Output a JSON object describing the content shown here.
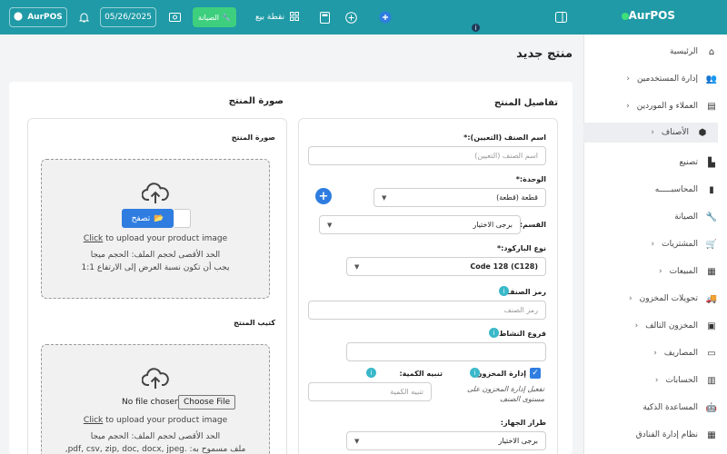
{
  "topbar": {
    "brand": "AurPOS",
    "pos_label": "نقطة بيع",
    "maintenance_label": "الصيانة",
    "date": "05/26/2025",
    "user_label": "AurPOS"
  },
  "sidebar": {
    "items": [
      {
        "label": "الرئيسية",
        "icon": "home-icon"
      },
      {
        "label": "إدارة المستخدمين",
        "icon": "users-icon"
      },
      {
        "label": "العملاء و الموردين",
        "icon": "address-book-icon"
      },
      {
        "label": "الأصناف",
        "icon": "cube-icon"
      },
      {
        "label": "تصنيع",
        "icon": "industry-icon"
      },
      {
        "label": "المحاسبـــــه",
        "icon": "book-icon"
      },
      {
        "label": "الصيانة",
        "icon": "wrench-icon"
      },
      {
        "label": "المشتريات",
        "icon": "cart-icon"
      },
      {
        "label": "المبيعات",
        "icon": "receipt-icon"
      },
      {
        "label": "تحويلات المخزون",
        "icon": "truck-icon"
      },
      {
        "label": "المخزون التالف",
        "icon": "damaged-box-icon"
      },
      {
        "label": "المصاريف",
        "icon": "wallet-icon"
      },
      {
        "label": "الحسابات",
        "icon": "calculator-icon"
      },
      {
        "label": "المساعدة الذكية",
        "icon": "robot-icon"
      },
      {
        "label": "نظام إدارة الفنادق",
        "icon": "hotel-icon"
      }
    ]
  },
  "page": {
    "title": "منتج جديد"
  },
  "details": {
    "title": "تفاصيل المنتج",
    "name_label": "اسم الصنف (التعيين):*",
    "name_placeholder": "اسم الصنف (التعيين)",
    "unit_label": "الوحدة:*",
    "unit_value": "قطعة (قطعة)",
    "category_label": "القسم:",
    "category_value": "برجى الاختيار",
    "barcode_label": "نوع الباركود:*",
    "barcode_value": "Code 128 (C128)",
    "sku_label": "رمز الصنف:",
    "sku_placeholder": "رمز الصنف",
    "branches_label": "فروع النشاط:",
    "manage_stock_label": "إدارة المخزون؟",
    "manage_stock_help": "تفعيل إدارة المخزون على مستوى الصنف",
    "alert_qty_label": "تنبيه الكمية:",
    "alert_qty_placeholder": "تنبيه الكمية",
    "device_model_label": "طراز الجهاز:",
    "device_model_value": "برجى الاختيار"
  },
  "image": {
    "title": "صورة المنتج",
    "inner_label": "صورة المنتج",
    "browse_label": "تصفح",
    "click_text": "Click",
    "upload_text": " to upload your product image",
    "max_size_text": "الحد الأقصى لحجم الملف: الحجم ميجا",
    "ratio_text": "يجب أن تكون نسبة العرض إلى الارتفاع 1:1"
  },
  "brochure": {
    "title": "كتيب المنتج",
    "no_file": "No file chosen",
    "choose_file": "Choose File",
    "click_text": "Click",
    "upload_text": " to upload your product image",
    "max_size_text": "الحد الأقصى لحجم الملف: الحجم ميجا",
    "allowed_text": "ملف مسموح به: .pdf, csv, zip, doc, docx, jpeg,"
  },
  "colors": {
    "topbar": "#1f9aa6",
    "accent": "#2f7de0",
    "maintenance": "#3ecf7e"
  }
}
